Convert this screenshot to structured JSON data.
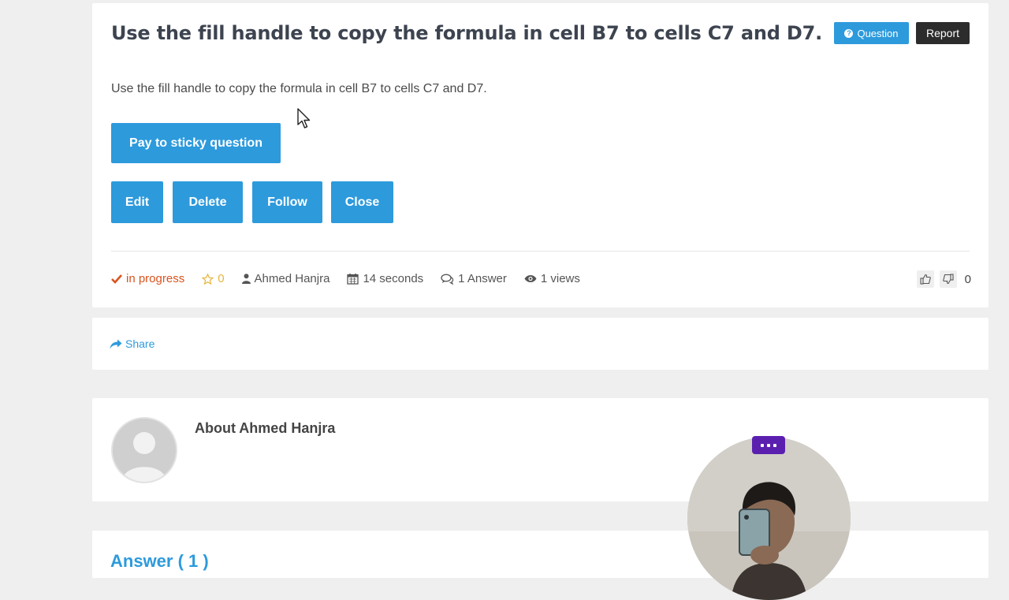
{
  "question": {
    "title": "Use the fill handle to copy the formula in cell B7 to cells C7 and D7.",
    "body": "Use the fill handle to copy the formula in cell B7 to cells C7 and D7.",
    "badge_question": "Question",
    "badge_report": "Report",
    "buttons": {
      "sticky": "Pay to sticky question",
      "edit": "Edit",
      "delete": "Delete",
      "follow": "Follow",
      "close": "Close"
    },
    "meta": {
      "status": "in progress",
      "stars": "0",
      "author": "Ahmed Hanjra",
      "time": "14 seconds",
      "answers": "1 Answer",
      "views": "1 views"
    },
    "vote_count": "0"
  },
  "share": {
    "label": "Share"
  },
  "about": {
    "title": "About Ahmed Hanjra"
  },
  "answers": {
    "title": "Answer ( 1 )"
  },
  "colors": {
    "accent": "#2d9adc",
    "report": "#2c2c2c",
    "status": "#d9531e",
    "star": "#e6b640",
    "webcam_menu": "#5b1fb0"
  }
}
